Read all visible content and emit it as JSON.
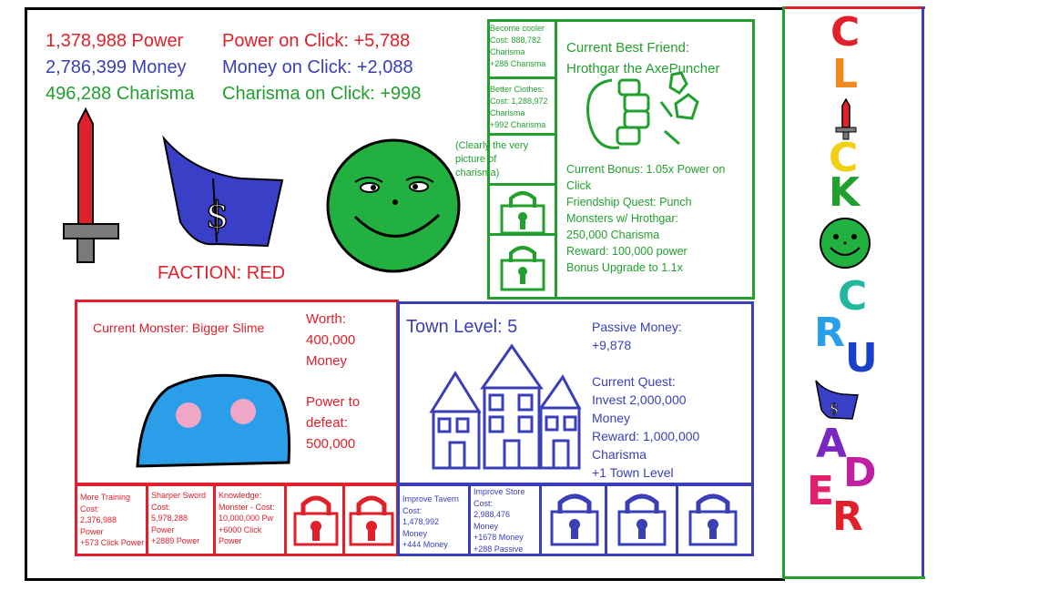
{
  "stats": {
    "power": "1,378,988 Power",
    "money": "2,786,399 Money",
    "charisma": "496,288 Charisma",
    "power_on_click": "Power on Click: +5,788",
    "money_on_click": "Money on Click: +2,088",
    "charisma_on_click": "Charisma on Click: +998"
  },
  "faction": "FACTION: RED",
  "charisma_shop": {
    "become_cooler": "Become cooler\nCost: 888,782\nCharisma\n+288 Charisma",
    "better_clothes": "Better Clothes:\nCost: 1,288,972\nCharisma\n+992 Charisma",
    "caption": "(Clearly the very\npicture of\ncharisma)"
  },
  "best_friend": {
    "title": "Current Best Friend:\nHrothgar the AxePuncher",
    "details": "Current Bonus: 1.05x Power on\nClick\nFriendship Quest: Punch\nMonsters w/ Hrothgar:\n250,000 Charisma\nReward: 100,000 power\nBonus Upgrade to 1.1x"
  },
  "monster": {
    "name": "Current Monster: Bigger Slime",
    "worth": "Worth:\n400,000\nMoney",
    "power_to_defeat": "Power to\ndefeat:\n500,000"
  },
  "power_shop": {
    "more_training": "More Training\nCost:\n2,376,988\nPower\n+573 Click Power",
    "sharper_sword": "Sharper Sword\nCost:\n5,978,288\nPower\n+2889 Power",
    "knowledge": "Knowledge:\nMonster - Cost:\n10,000,000 Pw\n+6000 Click\nPower"
  },
  "town": {
    "level": "Town Level: 5",
    "passive_money": "Passive Money:\n+9,878",
    "quest": "Current Quest:\nInvest 2,000,000\nMoney\nReward: 1,000,000\nCharisma\n+1 Town Level"
  },
  "money_shop": {
    "improve_tavern": "Improve Tavern\nCost:\n1,478,992\nMoney\n+444 Money",
    "improve_store": "Improve Store\nCost:\n2,988,476\nMoney\n+1678 Money\n+288 Passive"
  },
  "logo_letters": [
    "C",
    "L",
    "C",
    "K",
    "C",
    "R",
    "U",
    "A",
    "D",
    "E",
    "R"
  ],
  "colors": {
    "red": "#e0202a",
    "blue": "#3a3fb8",
    "green": "#22a02e"
  }
}
